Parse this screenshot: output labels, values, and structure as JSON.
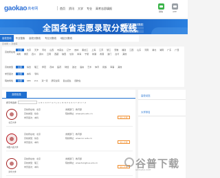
{
  "header": {
    "brand": "gaokao",
    "brand_cn": "高考网",
    "nav": [
      "首页",
      "资讯",
      "大学",
      "专业",
      "高考志愿填报"
    ],
    "icons": [
      {
        "icon": "wechat-icon",
        "label": "微信"
      },
      {
        "icon": "app-icon",
        "label": "APP"
      }
    ]
  },
  "banner": {
    "title": "全国各省志愿录取分数线",
    "badge_lines": [
      "全国高校录取分数线",
      "名校分数线",
      "最新分数线查询"
    ]
  },
  "tabs": [
    "高校查询",
    "专业搜索",
    "高校分数线",
    "专业分数线",
    "地区分数线"
  ],
  "breadcrumb": "高考网 > 高校库",
  "filters": {
    "location": {
      "label": "高校所在地",
      "options": [
        "全部",
        "北京",
        "天津",
        "河北",
        "山西",
        "内蒙古",
        "辽宁",
        "吉林",
        "黑龙江",
        "上海",
        "江苏",
        "浙江",
        "安徽",
        "福建",
        "江西",
        "山东",
        "河南",
        "湖北",
        "湖南",
        "广东",
        "广西",
        "海南",
        "重庆",
        "四川",
        "贵州",
        "云南",
        "西藏",
        "陕西",
        "甘肃",
        "青海",
        "宁夏",
        "新疆",
        "香港",
        "澳门",
        "台湾",
        "其他"
      ]
    },
    "type": {
      "label": "高校类型",
      "options": [
        "全部",
        "综合",
        "理工",
        "师范",
        "农林",
        "医药",
        "财经",
        "政法",
        "语言",
        "艺术",
        "体育",
        "民族",
        "军事",
        "其他"
      ]
    },
    "level": {
      "label": "学历层次",
      "options": [
        "全部",
        "本科",
        "专科"
      ]
    },
    "feature": {
      "label": "院校特色",
      "options": [
        "全部",
        "985",
        "211",
        "双一流",
        "研究生院",
        "自主招生",
        "国防生"
      ]
    }
  },
  "school_panel": {
    "title": "高校信息",
    "index_label": "按字母选择",
    "letters": "A B C D E F G H J K L M N P Q R S T W X Y Z",
    "cards": [
      {
        "name": "北京大学",
        "loc": "高校所在地：北京",
        "type": "高校类型：综合",
        "level": "学历层次：本科",
        "attr": "隶属部门：教育部",
        "site": "院校网址：www.pku.edu.cn",
        "more": "进入大学"
      },
      {
        "name": "中国人民大学",
        "loc": "高校所在地：北京",
        "type": "高校类型：综合",
        "level": "学历层次：本科",
        "attr": "隶属部门：教育部",
        "site": "院校网址：www.ruc.edu.cn",
        "more": "进入大学"
      },
      {
        "name": "清华大学",
        "loc": "高校所在地：北京",
        "type": "高校类型：理工",
        "level": "学历层次：本科",
        "attr": "隶属部门：教育部",
        "site": "院校网址：www.tsinghua.edu.cn",
        "more": "进入大学"
      }
    ]
  },
  "sidebar": {
    "blocks": [
      "高校动态",
      "大学排名"
    ]
  },
  "watermark": {
    "text": "谷普下载",
    "sub": "GPXIAZAI.COM"
  },
  "colors": {
    "accent": "#1f6fd0",
    "orange": "#f08c2a",
    "wechat": "#3bb44a"
  }
}
